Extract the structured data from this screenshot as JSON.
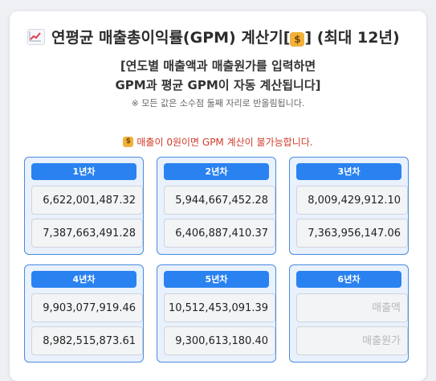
{
  "header": {
    "title_prefix": "연평균 매출총이익률(GPM) 계산기[",
    "title_suffix": "] (최대 12년)",
    "icons": {
      "title": "chart-increasing-icon",
      "bag": "money-bag-icon"
    }
  },
  "instructions": {
    "line1": "[연도별 매출액과 매출원가를 입력하면",
    "line2": "GPM과 평균 GPM이 자동 계산됩니다]",
    "note": "※ 모든 값은 소수점 둘째 자리로 반올림됩니다."
  },
  "warning": {
    "text": "매출이 0원이면 GPM 계산이 불가능합니다.",
    "color": "#d23a2a"
  },
  "colors": {
    "accent": "#2a82f0",
    "card_bg": "#e9f1fd"
  },
  "years": [
    {
      "label": "1년차",
      "revenue": "6,622,001,487.32",
      "cost": "7,387,663,491.28",
      "revenue_placeholder": "매출액",
      "cost_placeholder": "매출원가"
    },
    {
      "label": "2년차",
      "revenue": "5,944,667,452.28",
      "cost": "6,406,887,410.37",
      "revenue_placeholder": "매출액",
      "cost_placeholder": "매출원가"
    },
    {
      "label": "3년차",
      "revenue": "8,009,429,912.10",
      "cost": "7,363,956,147.06",
      "revenue_placeholder": "매출액",
      "cost_placeholder": "매출원가"
    },
    {
      "label": "4년차",
      "revenue": "9,903,077,919.46",
      "cost": "8,982,515,873.61",
      "revenue_placeholder": "매출액",
      "cost_placeholder": "매출원가"
    },
    {
      "label": "5년차",
      "revenue": "10,512,453,091.39",
      "cost": "9,300,613,180.40",
      "revenue_placeholder": "매출액",
      "cost_placeholder": "매출원가"
    },
    {
      "label": "6년차",
      "revenue": "",
      "cost": "",
      "revenue_placeholder": "매출액",
      "cost_placeholder": "매출원가"
    }
  ]
}
